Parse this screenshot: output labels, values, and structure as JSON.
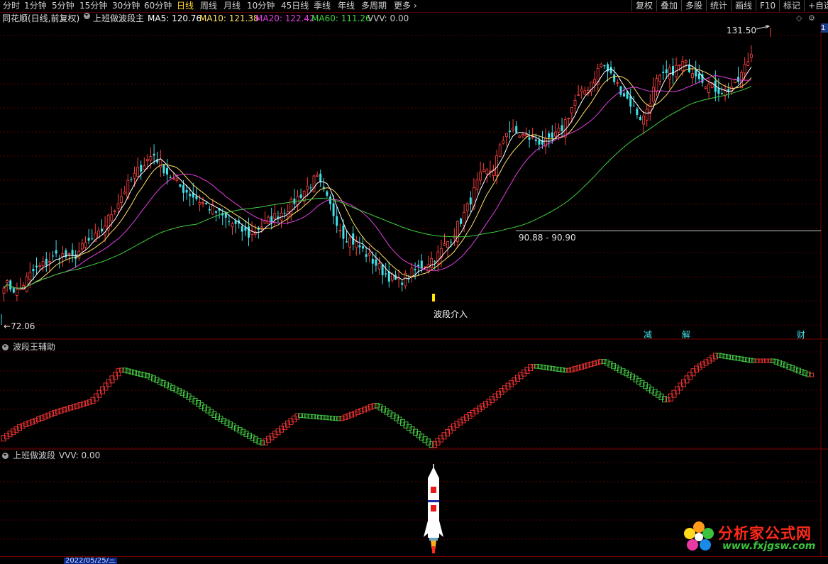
{
  "toolbar": {
    "tabs": [
      "分时",
      "1分钟",
      "5分钟",
      "15分钟",
      "30分钟",
      "60分钟",
      "日线",
      "周线",
      "月线",
      "10分钟",
      "45日线",
      "季线",
      "年线",
      "多周期",
      "更多"
    ],
    "active_tab": "日线",
    "right_buttons": [
      "复权",
      "叠加",
      "多股",
      "统计",
      "画线",
      "F10",
      "标记",
      "+自选"
    ]
  },
  "info_bar": {
    "stock_name": "同花顺(日线,前复权)",
    "indicator_name": "上班做波段主",
    "ma5": "MA5: 120.76",
    "ma10": "MA10: 121.38",
    "ma20": "MA20: 122.42",
    "ma60": "MA60: 111.26",
    "vvv": "VVV: 0.00"
  },
  "main_chart": {
    "high_label": "131.50",
    "low_label": "72.06",
    "level_label": "90.88 - 90.90",
    "signal_label": "波段介入",
    "event_labels": [
      "减",
      "解",
      "财"
    ],
    "edge_label": "1"
  },
  "panel2": {
    "title": "波段王辅助"
  },
  "panel3": {
    "title": "上班做波段",
    "vvv": "VVV: 0.00"
  },
  "bottom_bar": {
    "date": "2022/05/25/三"
  },
  "watermark": {
    "name": "分析家公式网",
    "url": "www.fxjgsw.com"
  },
  "colors": {
    "up": "#ff4040",
    "down": "#40e0e8",
    "ma5": "#ffffff",
    "ma10": "#ffe066",
    "ma20": "#e040e0",
    "ma60": "#40d040",
    "grid": "#5a0000",
    "wave_up": "#e83030",
    "wave_down": "#40c040"
  },
  "chart_data": {
    "type": "candlestick",
    "y_high": 131.5,
    "y_low": 72.06,
    "level": 90.89,
    "close_series": [
      80,
      78,
      82,
      84,
      86,
      85,
      88,
      90,
      95,
      100,
      104,
      107,
      103,
      100,
      98,
      96,
      94,
      92,
      90,
      92,
      94,
      96,
      99,
      102,
      96,
      90,
      88,
      85,
      82,
      80,
      82,
      84,
      86,
      90,
      95,
      102,
      104,
      112,
      111,
      110,
      109,
      112,
      118,
      121,
      126,
      122,
      118,
      114,
      122,
      124,
      126,
      124,
      121,
      120,
      122,
      128
    ]
  }
}
